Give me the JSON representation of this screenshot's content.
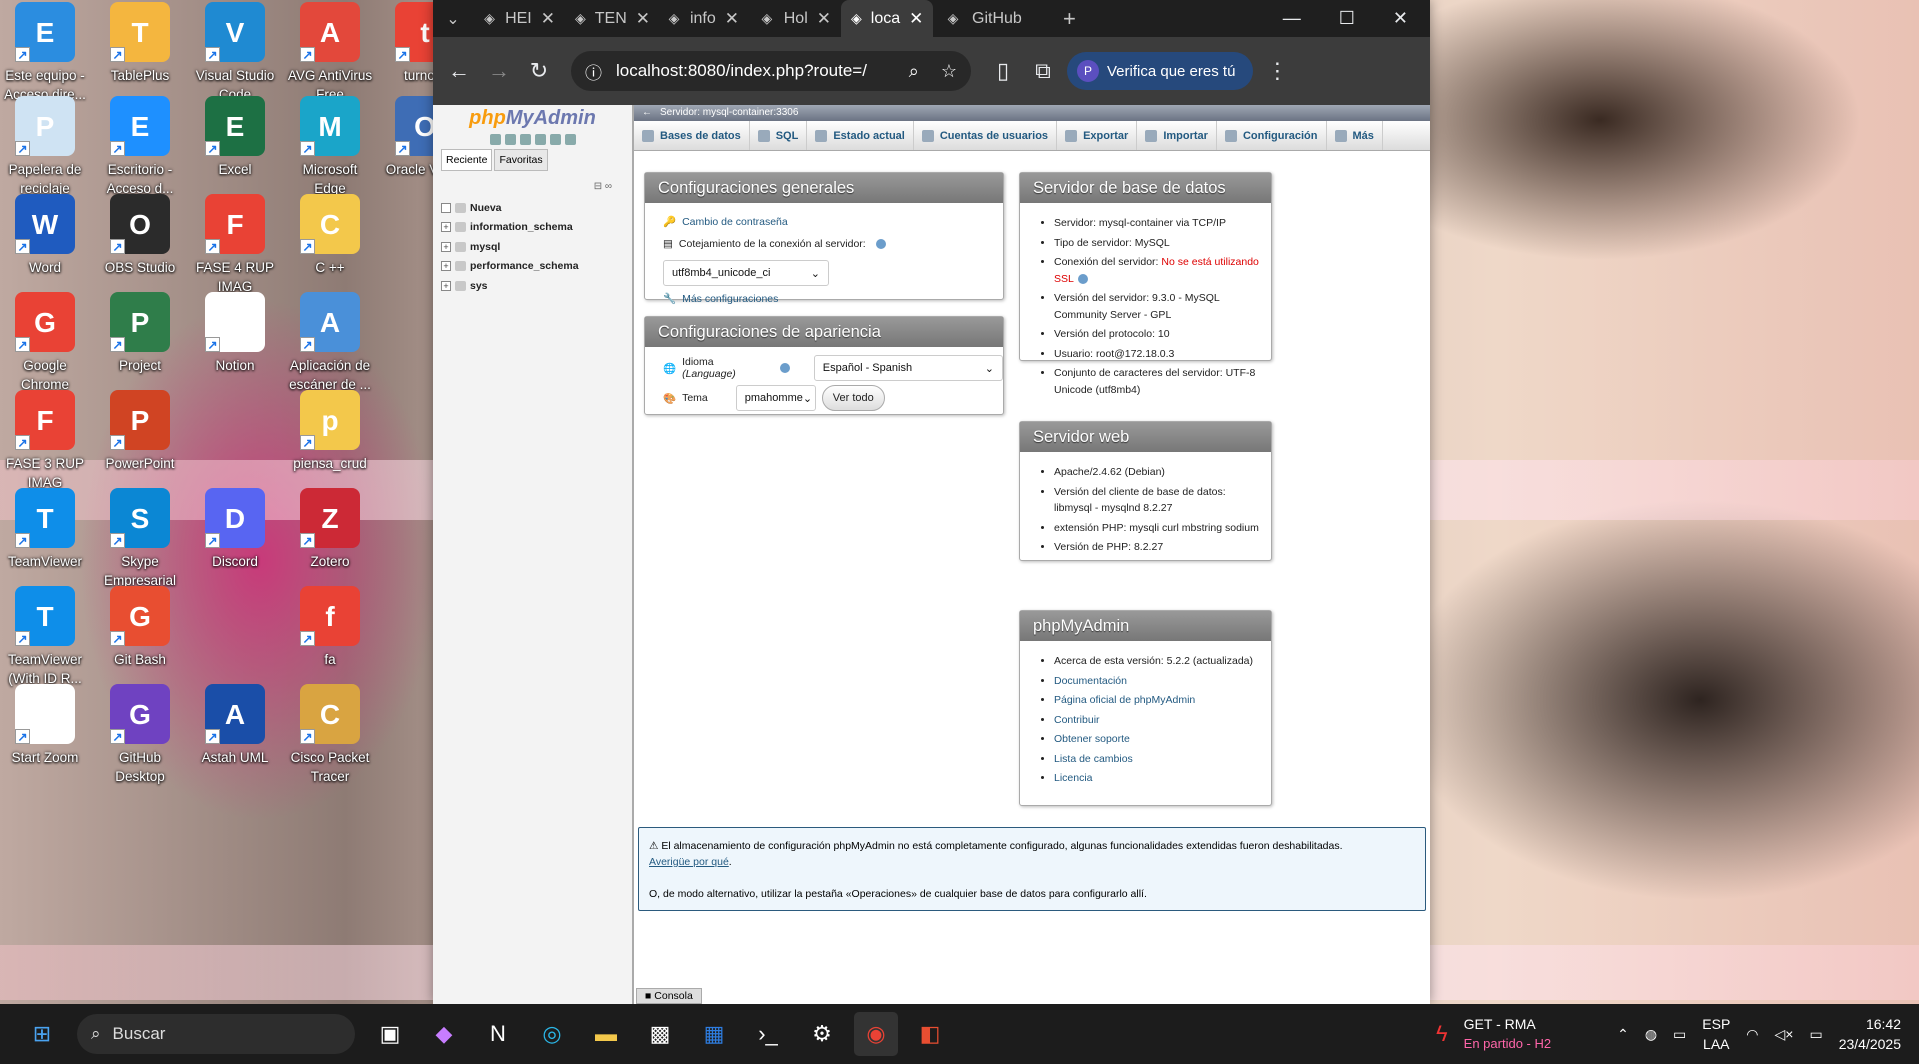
{
  "desktop": {
    "icons": [
      {
        "label": "Este equipo - Acceso dire...",
        "icon": "computer-icon",
        "color": "#2b8de0"
      },
      {
        "label": "TablePlus",
        "icon": "elephant-icon",
        "color": "#f4b63f"
      },
      {
        "label": "Visual Studio Code",
        "icon": "vscode-icon",
        "color": "#1f8ad2"
      },
      {
        "label": "AVG AntiVirus Free",
        "icon": "avg-icon",
        "color": "#e3483b"
      },
      {
        "label": "turno e",
        "icon": "chrome-icon",
        "color": "#e94235"
      },
      {
        "label": "Papelera de reciclaje",
        "icon": "recycle-bin-icon",
        "color": "#cfe3f3"
      },
      {
        "label": "Escritorio - Acceso d...",
        "icon": "folder-icon",
        "color": "#1e90ff"
      },
      {
        "label": "Excel",
        "icon": "excel-icon",
        "color": "#1d7044"
      },
      {
        "label": "Microsoft Edge",
        "icon": "edge-icon",
        "color": "#1aa5c9"
      },
      {
        "label": "Oracle Virtua",
        "icon": "virtualbox-icon",
        "color": "#3e6db5"
      },
      {
        "label": "Word",
        "icon": "word-icon",
        "color": "#1f5bbf"
      },
      {
        "label": "OBS Studio",
        "icon": "obs-icon",
        "color": "#2b2b2b"
      },
      {
        "label": "FASE 4 RUP IMAG",
        "icon": "chrome-icon",
        "color": "#e94235"
      },
      {
        "label": "C ++",
        "icon": "folder-icon",
        "color": "#f3c84b"
      },
      {
        "label": "Google Chrome",
        "icon": "chrome-icon",
        "color": "#e94235"
      },
      {
        "label": "Project",
        "icon": "project-icon",
        "color": "#2f7d4a"
      },
      {
        "label": "Notion",
        "icon": "notion-icon",
        "color": "#ffffff"
      },
      {
        "label": "Aplicación de escáner de ...",
        "icon": "scanner-icon",
        "color": "#4a90d9"
      },
      {
        "label": "FASE 3 RUP IMAG",
        "icon": "chrome-icon",
        "color": "#e94235"
      },
      {
        "label": "PowerPoint",
        "icon": "powerpoint-icon",
        "color": "#d04423"
      },
      {
        "label": "piensa_crud",
        "icon": "folder-icon",
        "color": "#f3c84b"
      },
      {
        "label": "TeamViewer",
        "icon": "teamviewer-icon",
        "color": "#0e8ee9"
      },
      {
        "label": "Skype Empresarial",
        "icon": "skype-icon",
        "color": "#0b87d4"
      },
      {
        "label": "Discord",
        "icon": "discord-icon",
        "color": "#5865f2"
      },
      {
        "label": "Zotero",
        "icon": "zotero-icon",
        "color": "#cc2936"
      },
      {
        "label": "TeamViewer (With ID R...",
        "icon": "teamviewer-icon",
        "color": "#0e8ee9"
      },
      {
        "label": "Git Bash",
        "icon": "git-icon",
        "color": "#e84e31"
      },
      {
        "label": "fa",
        "icon": "chrome-icon",
        "color": "#e94235"
      },
      {
        "label": "Start Zoom",
        "icon": "file-icon",
        "color": "#ffffff"
      },
      {
        "label": "GitHub Desktop",
        "icon": "github-desktop-icon",
        "color": "#6f42c1"
      },
      {
        "label": "Astah UML",
        "icon": "astah-icon",
        "color": "#1a4ea8"
      },
      {
        "label": "Cisco Packet Tracer",
        "icon": "packet-tracer-icon",
        "color": "#d9a441"
      }
    ]
  },
  "browser": {
    "tabs": [
      {
        "label": "HEI",
        "icon": "doc-icon"
      },
      {
        "label": "TEN",
        "icon": "doc-icon"
      },
      {
        "label": "info",
        "icon": "github-icon"
      },
      {
        "label": "Hol",
        "icon": "openai-icon"
      },
      {
        "label": "loca",
        "icon": "pma-icon",
        "active": true
      },
      {
        "label": "GitHub",
        "icon": "github-icon"
      }
    ],
    "url": "localhost:8080/index.php?route=/",
    "profile_label": "Verifica que eres tú",
    "profile_initial": "P"
  },
  "pma": {
    "logo_a": "php",
    "logo_b": "MyAdmin",
    "nav_tabs": [
      "Reciente",
      "Favoritas"
    ],
    "databases": [
      "Nueva",
      "information_schema",
      "mysql",
      "performance_schema",
      "sys"
    ],
    "server_bar": "Servidor: mysql-container:3306",
    "menu": [
      "Bases de datos",
      "SQL",
      "Estado actual",
      "Cuentas de usuarios",
      "Exportar",
      "Importar",
      "Configuración",
      "Más"
    ],
    "general": {
      "title": "Configuraciones generales",
      "change_pw": "Cambio de contraseña",
      "collation_label": "Cotejamiento de la conexión al servidor:",
      "collation_value": "utf8mb4_unicode_ci",
      "more": "Más configuraciones"
    },
    "appearance": {
      "title": "Configuraciones de apariencia",
      "lang_label": "Idioma",
      "lang_label_en": "(Language)",
      "lang_value": "Español - Spanish",
      "theme_label": "Tema",
      "theme_value": "pmahomme",
      "view_all": "Ver todo"
    },
    "db_server": {
      "title": "Servidor de base de datos",
      "items": [
        {
          "label": "Servidor: mysql-container via TCP/IP"
        },
        {
          "label": "Tipo de servidor: MySQL"
        },
        {
          "label": "Conexión del servidor:",
          "alert": "No se está utilizando SSL"
        },
        {
          "label": "Versión del servidor: 9.3.0 - MySQL Community Server - GPL"
        },
        {
          "label": "Versión del protocolo: 10"
        },
        {
          "label": "Usuario: root@172.18.0.3"
        },
        {
          "label": "Conjunto de caracteres del servidor: UTF-8 Unicode (utf8mb4)"
        }
      ]
    },
    "web_server": {
      "title": "Servidor web",
      "items": [
        "Apache/2.4.62 (Debian)",
        "Versión del cliente de base de datos: libmysql - mysqlnd 8.2.27",
        "extensión PHP: mysqli  curl  mbstring  sodium",
        "Versión de PHP: 8.2.27"
      ]
    },
    "about": {
      "title": "phpMyAdmin",
      "items": [
        "Acerca de esta versión: 5.2.2 (actualizada)",
        "Documentación",
        "Página oficial de phpMyAdmin",
        "Contribuir",
        "Obtener soporte",
        "Lista de cambios",
        "Licencia"
      ]
    },
    "notice": {
      "text": "El almacenamiento de configuración phpMyAdmin no está completamente configurado, algunas funcionalidades extendidas fueron deshabilitadas.",
      "link": "Averigüe por qué",
      "text2": "O, de modo alternativo, utilizar la pestaña «Operaciones» de cualquier base de datos para configurarlo allí."
    },
    "console": "Consola"
  },
  "taskbar": {
    "search": "Buscar",
    "weather_title": "GET - RMA",
    "weather_sub": "En partido - H2",
    "lang": "ESP",
    "lang2": "LAA",
    "time": "16:42",
    "date": "23/4/2025"
  }
}
